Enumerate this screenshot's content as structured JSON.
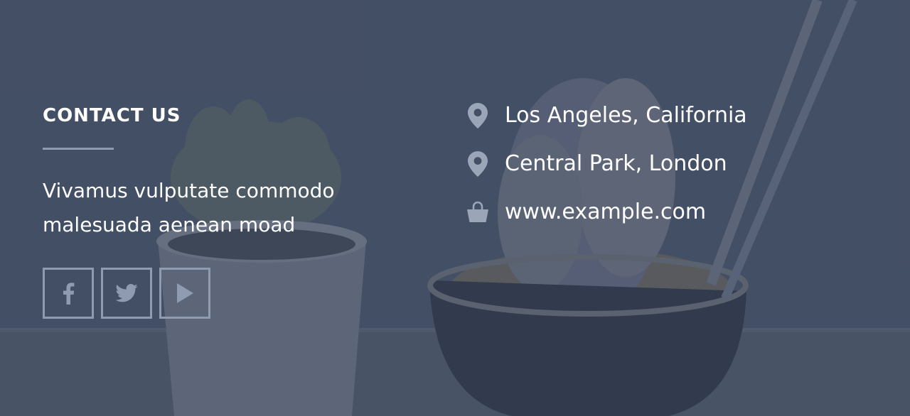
{
  "contact": {
    "title": "CONTACT US",
    "tagline": "Vivamus vulputate commodo malesuada aenean moad"
  },
  "social": [
    {
      "name": "facebook",
      "icon": "facebook-icon"
    },
    {
      "name": "twitter",
      "icon": "twitter-icon"
    },
    {
      "name": "youtube",
      "icon": "play-icon"
    }
  ],
  "info": {
    "location_1": "Los Angeles, California",
    "location_2": "Central Park, London",
    "website": "www.example.com",
    "icons": {
      "location_1": "map-pin-icon",
      "location_2": "map-pin-icon",
      "website": "shopping-bag-icon"
    }
  },
  "colors": {
    "overlay": "#434f61",
    "accent_line": "#8e9bb0",
    "text": "#ffffff"
  }
}
